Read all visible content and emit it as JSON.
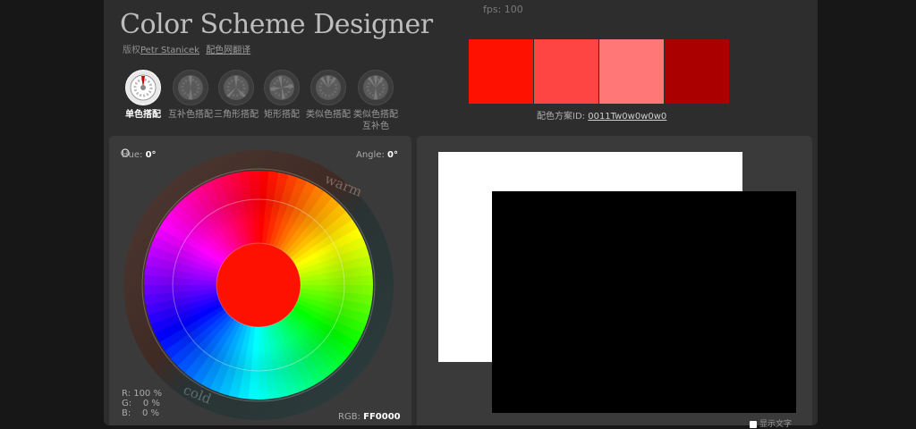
{
  "header": {
    "fps": "fps: 100",
    "title": "Color Scheme Designer",
    "credit_prefix": "版权",
    "credit_author": "Petr Stanicek",
    "credit_link": "配色网翻译"
  },
  "modes": [
    {
      "label": "单色搭配",
      "icon": "mono-wheel-icon",
      "active": true
    },
    {
      "label": "互补色搭配",
      "icon": "complement-wheel-icon",
      "active": false
    },
    {
      "label": "三角形搭配",
      "icon": "triad-wheel-icon",
      "active": false
    },
    {
      "label": "矩形搭配",
      "icon": "tetrad-wheel-icon",
      "active": false
    },
    {
      "label": "类似色搭配",
      "icon": "analogic-wheel-icon",
      "active": false
    },
    {
      "label": "类似色搭配互补色",
      "icon": "accented-analogic-wheel-icon",
      "active": false
    }
  ],
  "swatches": [
    "#FF1100",
    "#FF4444",
    "#FF7777",
    "#AA0000"
  ],
  "scheme": {
    "label": "配色方案ID:",
    "id": "0011Tw0w0w0w0"
  },
  "wheel": {
    "hue_label": "Hue:",
    "hue_value": "0°",
    "angle_label": "Angle:",
    "angle_value": "0°",
    "warm_label": "warm",
    "cold_label": "cold",
    "r_label": "R:",
    "r_value": "100 %",
    "g_label": "G:",
    "g_value": "0 %",
    "b_label": "B:",
    "b_value": "0 %",
    "rgb_label": "RGB:",
    "rgb_value": "FF0000",
    "center_color": "#FF1100"
  },
  "preview": {
    "checkbox_label": "显示文字"
  }
}
